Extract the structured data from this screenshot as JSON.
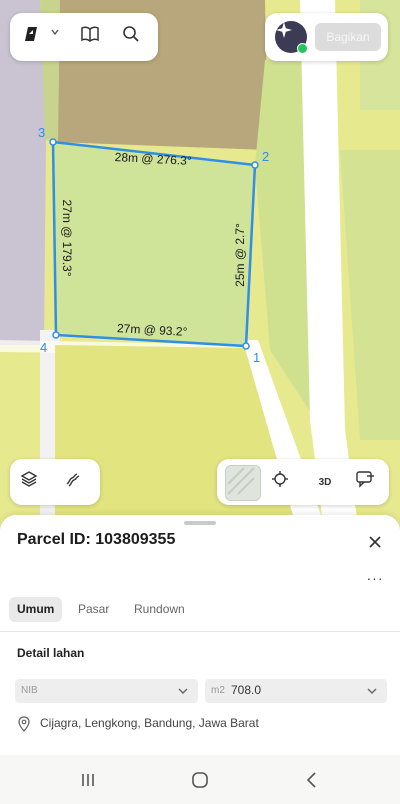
{
  "toolbar": {
    "share_label": "Bagikan"
  },
  "map": {
    "vertices": [
      {
        "label": "1"
      },
      {
        "label": "2"
      },
      {
        "label": "3"
      },
      {
        "label": "4"
      }
    ],
    "edges": [
      {
        "label": "28m @ 276.3°"
      },
      {
        "label": "25m @ 2.7°"
      },
      {
        "label": "27m @ 93.2°"
      },
      {
        "label": "27m @ 179.3°"
      }
    ],
    "view_3d_label": "3D"
  },
  "sheet": {
    "title": "Parcel ID: 103809355",
    "tabs": [
      {
        "label": "Umum"
      },
      {
        "label": "Pasar"
      },
      {
        "label": "Rundown"
      }
    ],
    "section_title": "Detail lahan",
    "nib": {
      "label": "NIB",
      "value": ""
    },
    "area": {
      "unit": "m2",
      "value": "708.0"
    },
    "address": "Cijagra, Lengkong, Bandung, Jawa Barat"
  },
  "colors": {
    "accent": "#2f8fe6",
    "parcel_fill": "#cde39a",
    "map_yellow": "#e4e68a",
    "map_brown": "#b9a980",
    "status_dot": "#22c55e"
  }
}
